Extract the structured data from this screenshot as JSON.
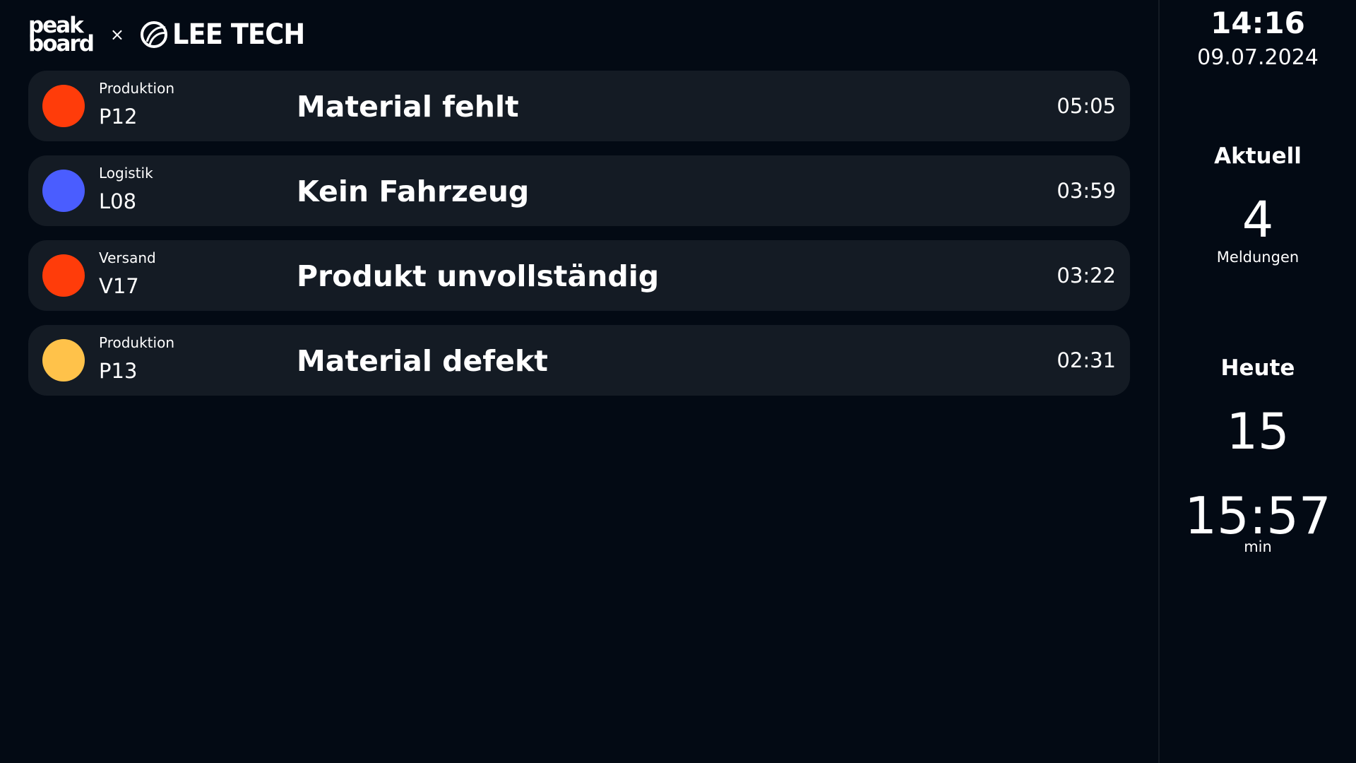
{
  "header": {
    "logo_peak_line1": "peak",
    "logo_peak_line2": "board",
    "separator": "×",
    "logo_partner": "LEE TECH"
  },
  "alerts": [
    {
      "department": "Produktion",
      "code": "P12",
      "message": "Material fehlt",
      "duration": "05:05",
      "color": "#ff3c0a"
    },
    {
      "department": "Logistik",
      "code": "L08",
      "message": "Kein Fahrzeug",
      "duration": "03:59",
      "color": "#4a5dff"
    },
    {
      "department": "Versand",
      "code": "V17",
      "message": "Produkt unvollständig",
      "duration": "03:22",
      "color": "#ff3c0a"
    },
    {
      "department": "Produktion",
      "code": "P13",
      "message": "Material defekt",
      "duration": "02:31",
      "color": "#ffc24a"
    }
  ],
  "sidebar": {
    "time": "14:16",
    "date": "09.07.2024",
    "current": {
      "title": "Aktuell",
      "count": "4",
      "label": "Meldungen"
    },
    "today": {
      "title": "Heute",
      "count": "15",
      "total_time": "15:57",
      "unit": "min"
    }
  }
}
